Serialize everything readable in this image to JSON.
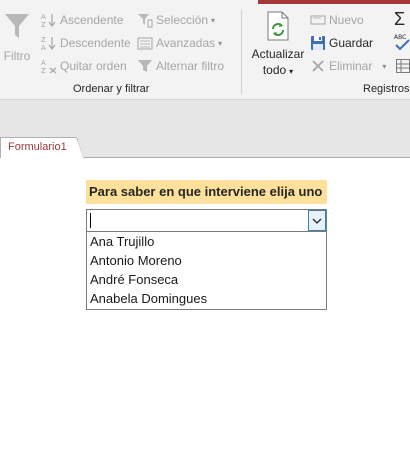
{
  "ribbon": {
    "groups": {
      "filter": {
        "filter_label": "Filtro",
        "ascending_label": "Ascendente",
        "descending_label": "Descendente",
        "remove_sort_label": "Quitar orden",
        "selection_label": "Selección",
        "advanced_label": "Avanzadas",
        "toggle_filter_label": "Alternar filtro",
        "group_label": "Ordenar y filtrar"
      },
      "records": {
        "refresh_label_line1": "Actualizar",
        "refresh_label_line2": "todo",
        "new_label": "Nuevo",
        "save_label": "Guardar",
        "delete_label": "Eliminar",
        "group_label": "Registros"
      }
    }
  },
  "tabs": [
    {
      "label": "Formulario1"
    }
  ],
  "form": {
    "prompt_label": "Para saber en que interviene elija uno",
    "combo_value": "",
    "options": [
      "Ana Trujillo",
      "Antonio Moreno",
      "André Fonseca",
      "Anabela Domingues"
    ]
  },
  "colors": {
    "accent": "#a4373a",
    "label_background": "#fde19a",
    "dropdown_button": "#e5f1fb"
  }
}
